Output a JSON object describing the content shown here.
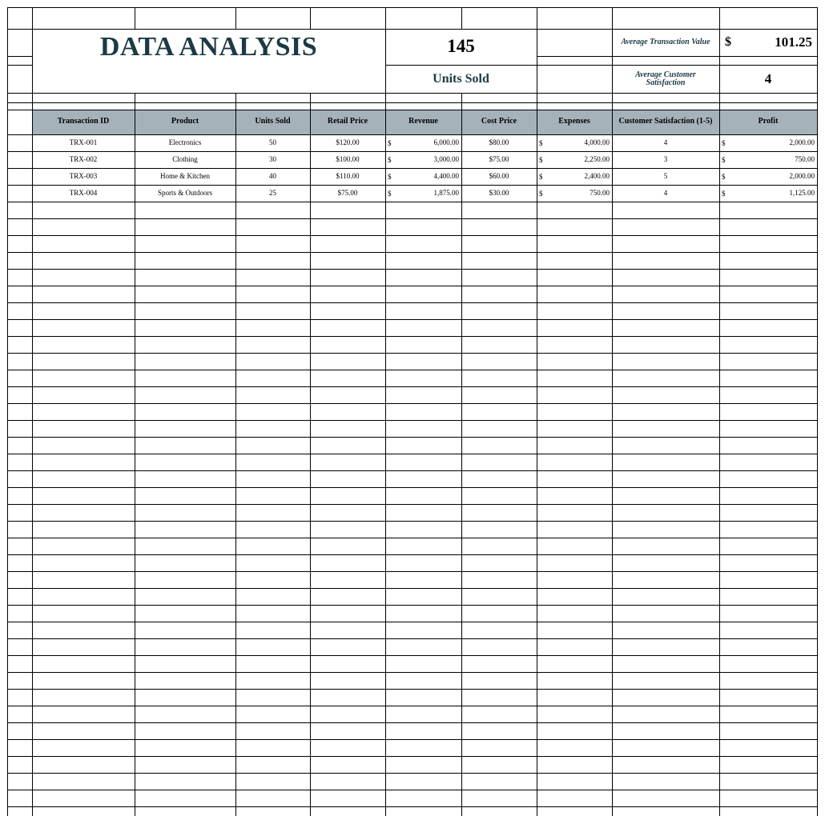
{
  "dashboard": {
    "title": "DATA ANALYSIS",
    "units_sold_value": "145",
    "units_sold_label": "Units Sold",
    "avg_transaction_label": "Average Transaction Value",
    "avg_transaction_currency": "$",
    "avg_transaction_value": "101.25",
    "avg_satisfaction_label": "Average Customer Satisfaction",
    "avg_satisfaction_value": "4"
  },
  "table": {
    "headers": [
      "Transaction ID",
      "Product",
      "Units Sold",
      "Retail Price",
      "Revenue",
      "Cost Price",
      "Expenses",
      "Customer Satisfaction (1-5)",
      "Profit"
    ],
    "currency_symbol": "$",
    "rows": [
      [
        "TRX-001",
        "Electronics",
        "50",
        "$120.00",
        "6,000.00",
        "$80.00",
        "4,000.00",
        "4",
        "2,000.00"
      ],
      [
        "TRX-002",
        "Clothing",
        "30",
        "$100.00",
        "3,000.00",
        "$75.00",
        "2,250.00",
        "3",
        "750.00"
      ],
      [
        "TRX-003",
        "Home & Kitchen",
        "40",
        "$110.00",
        "4,400.00",
        "$60.00",
        "2,400.00",
        "5",
        "2,000.00"
      ],
      [
        "TRX-004",
        "Sports & Outdoors",
        "25",
        "$75.00",
        "1,875.00",
        "$30.00",
        "750.00",
        "4",
        "1,125.00"
      ]
    ]
  },
  "colors": {
    "header_fill": "#a6b2b9",
    "title_color": "#1b3a44",
    "grid_color": "#000000"
  }
}
